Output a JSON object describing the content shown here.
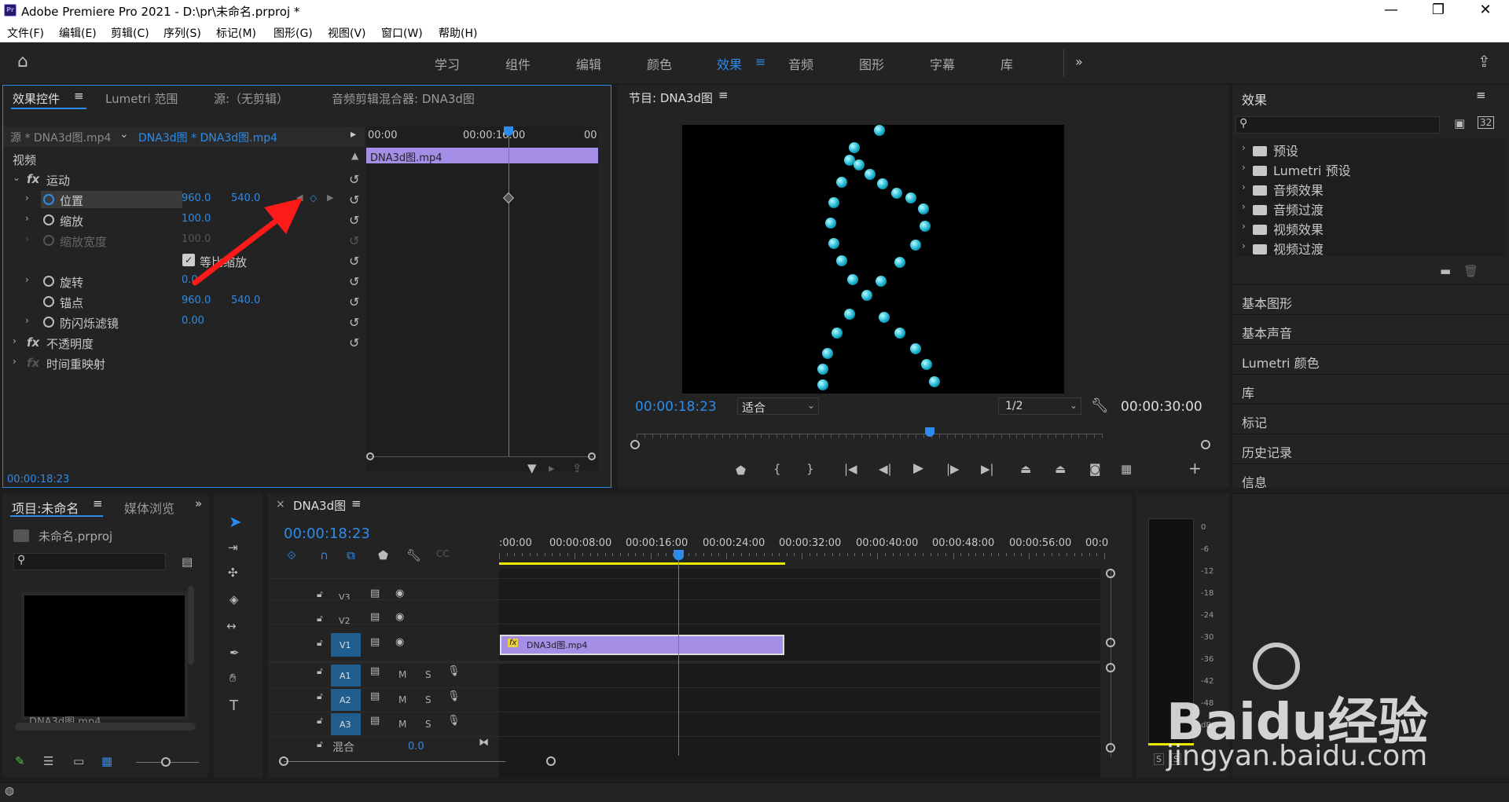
{
  "window": {
    "title": "Adobe Premiere Pro 2021 - D:\\pr\\未命名.prproj *",
    "logo": "Pr"
  },
  "menu": [
    "文件(F)",
    "编辑(E)",
    "剪辑(C)",
    "序列(S)",
    "标记(M)",
    "图形(G)",
    "视图(V)",
    "窗口(W)",
    "帮助(H)"
  ],
  "workspaces": [
    "学习",
    "组件",
    "编辑",
    "颜色",
    "效果",
    "音频",
    "图形",
    "字幕",
    "库"
  ],
  "active_workspace": "效果",
  "effect_controls": {
    "tabs": [
      "效果控件",
      "Lumetri 范围",
      "源:（无剪辑）",
      "音频剪辑混合器: DNA3d图"
    ],
    "source": "源 * DNA3d图.mp4",
    "clip": "DNA3d图 * DNA3d图.mp4",
    "section_video": "视频",
    "motion": "运动",
    "position_label": "位置",
    "position_x": "960.0",
    "position_y": "540.0",
    "scale_label": "缩放",
    "scale_value": "100.0",
    "scale_width_label": "缩放宽度",
    "scale_width_value": "100.0",
    "uniform_label": "等比缩放",
    "rotation_label": "旋转",
    "rotation_value": "0.0",
    "anchor_label": "锚点",
    "anchor_x": "960.0",
    "anchor_y": "540.0",
    "flicker_label": "防闪烁滤镜",
    "flicker_value": "0.00",
    "opacity_label": "不透明度",
    "remap_label": "时间重映射",
    "ruler": [
      "00:00",
      "00:00:16:00",
      "00"
    ],
    "clip_bar": "DNA3d图.mp4",
    "timecode": "00:00:18:23"
  },
  "program": {
    "title": "节目: DNA3d图",
    "timecode": "00:00:18:23",
    "fit": "适合",
    "resolution": "1/2",
    "duration": "00:00:30:00",
    "playhead_fraction": 0.63
  },
  "effects": {
    "title": "效果",
    "items": [
      "预设",
      "Lumetri 预设",
      "音频效果",
      "音频过渡",
      "视频效果",
      "视频过渡"
    ],
    "sections": [
      "基本图形",
      "基本声音",
      "Lumetri 颜色",
      "库",
      "标记",
      "历史记录",
      "信息"
    ]
  },
  "project": {
    "tabs": [
      "项目:未命名",
      "媒体浏览"
    ],
    "file": "未命名.prproj",
    "thumb_label": "DNA3d图.mp4"
  },
  "timeline": {
    "tab": "DNA3d图",
    "timecode": "00:00:18:23",
    "ruler": [
      ":00:00",
      "00:00:08:00",
      "00:00:16:00",
      "00:00:24:00",
      "00:00:32:00",
      "00:00:40:00",
      "00:00:48:00",
      "00:00:56:00",
      "00:0"
    ],
    "video_tracks": [
      "V3",
      "V2",
      "V1"
    ],
    "audio_tracks": [
      "A1",
      "A2",
      "A3"
    ],
    "mix_label": "混合",
    "mix_value": "0.0",
    "clip": "DNA3d图.mp4",
    "clip_fx": "fx",
    "M": "M",
    "S": "S"
  },
  "meter": {
    "ticks": [
      "0",
      "-6",
      "-12",
      "-18",
      "-24",
      "-30",
      "-36",
      "-42",
      "-48",
      "dB"
    ],
    "solo": "S"
  },
  "watermark": {
    "text": "Baidu经验",
    "url": "jingyan.baidu.com"
  }
}
